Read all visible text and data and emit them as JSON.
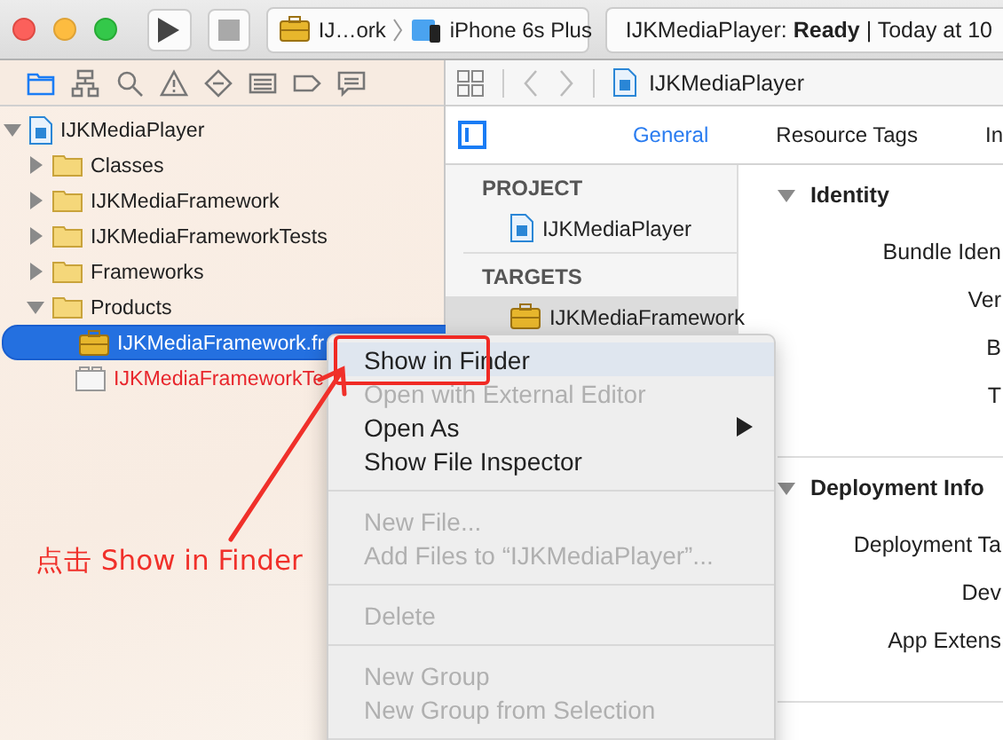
{
  "toolbar": {
    "scheme": "IJ…ork",
    "destination": "iPhone 6s Plus",
    "status": "IJKMediaPlayer: **Ready**  |  Today at 10"
  },
  "navigator": {
    "tabs": [
      {
        "kind": "folder",
        "selected": true
      },
      {
        "kind": "hierarchy",
        "selected": false
      },
      {
        "kind": "search",
        "selected": false
      },
      {
        "kind": "warning",
        "selected": false
      },
      {
        "kind": "test",
        "selected": false
      },
      {
        "kind": "debug",
        "selected": false
      },
      {
        "kind": "breakpoint",
        "selected": false
      },
      {
        "kind": "report",
        "selected": false
      }
    ],
    "tree": [
      {
        "name": "IJKMediaPlayer",
        "kind": "project",
        "expanded": true,
        "selected": false,
        "missing": false,
        "children": [
          {
            "name": "Classes",
            "kind": "folder",
            "expanded": false,
            "selected": false,
            "missing": false
          },
          {
            "name": "IJKMediaFramework",
            "kind": "folder",
            "expanded": false,
            "selected": false,
            "missing": false
          },
          {
            "name": "IJKMediaFrameworkTests",
            "kind": "folder",
            "expanded": false,
            "selected": false,
            "missing": false
          },
          {
            "name": "Frameworks",
            "kind": "folder",
            "expanded": false,
            "selected": false,
            "missing": false
          },
          {
            "name": "Products",
            "kind": "folder",
            "expanded": true,
            "selected": false,
            "missing": false,
            "children": [
              {
                "name": "IJKMediaFramework.fr",
                "kind": "framework",
                "selected": true,
                "missing": false
              },
              {
                "name": "IJKMediaFrameworkTe",
                "kind": "bundle",
                "selected": false,
                "missing": true
              }
            ]
          }
        ]
      }
    ]
  },
  "jump_bar": {
    "path": "IJKMediaPlayer"
  },
  "editor": {
    "tabs": [
      {
        "label": "General",
        "selected": true
      },
      {
        "label": "Resource Tags",
        "selected": false
      },
      {
        "label": "In",
        "selected": false
      }
    ],
    "sections": [
      {
        "title": "PROJECT",
        "items": [
          {
            "name": "IJKMediaPlayer",
            "kind": "project",
            "selected": false
          }
        ]
      },
      {
        "title": "TARGETS",
        "items": [
          {
            "name": "IJKMediaFramework",
            "kind": "framework",
            "selected": true
          }
        ]
      }
    ],
    "settings": [
      {
        "title": "Identity",
        "expanded": true,
        "fields": [
          "Bundle Iden",
          "Ver",
          "B",
          "T"
        ]
      },
      {
        "title": "Deployment Info",
        "expanded": true,
        "fields": [
          "Deployment Ta",
          "Dev",
          "App Extens"
        ]
      }
    ]
  },
  "context_menu": [
    {
      "kind": "item",
      "label": "Show in Finder",
      "disabled": false,
      "selected": true,
      "submenu": false
    },
    {
      "kind": "item",
      "label": "Open with External Editor",
      "disabled": true,
      "selected": false,
      "submenu": false
    },
    {
      "kind": "item",
      "label": "Open As",
      "disabled": false,
      "selected": false,
      "submenu": true
    },
    {
      "kind": "item",
      "label": "Show File Inspector",
      "disabled": false,
      "selected": false,
      "submenu": false
    },
    {
      "kind": "separator"
    },
    {
      "kind": "item",
      "label": "New File...",
      "disabled": true,
      "selected": false,
      "submenu": false
    },
    {
      "kind": "item",
      "label": "Add Files to “IJKMediaPlayer”...",
      "disabled": true,
      "selected": false,
      "submenu": false
    },
    {
      "kind": "separator"
    },
    {
      "kind": "item",
      "label": "Delete",
      "disabled": true,
      "selected": false,
      "submenu": false
    },
    {
      "kind": "separator"
    },
    {
      "kind": "item",
      "label": "New Group",
      "disabled": true,
      "selected": false,
      "submenu": false
    },
    {
      "kind": "item",
      "label": "New Group from Selection",
      "disabled": true,
      "selected": false,
      "submenu": false
    },
    {
      "kind": "separator"
    }
  ],
  "annotation": {
    "text": "点击 Show in Finder"
  }
}
